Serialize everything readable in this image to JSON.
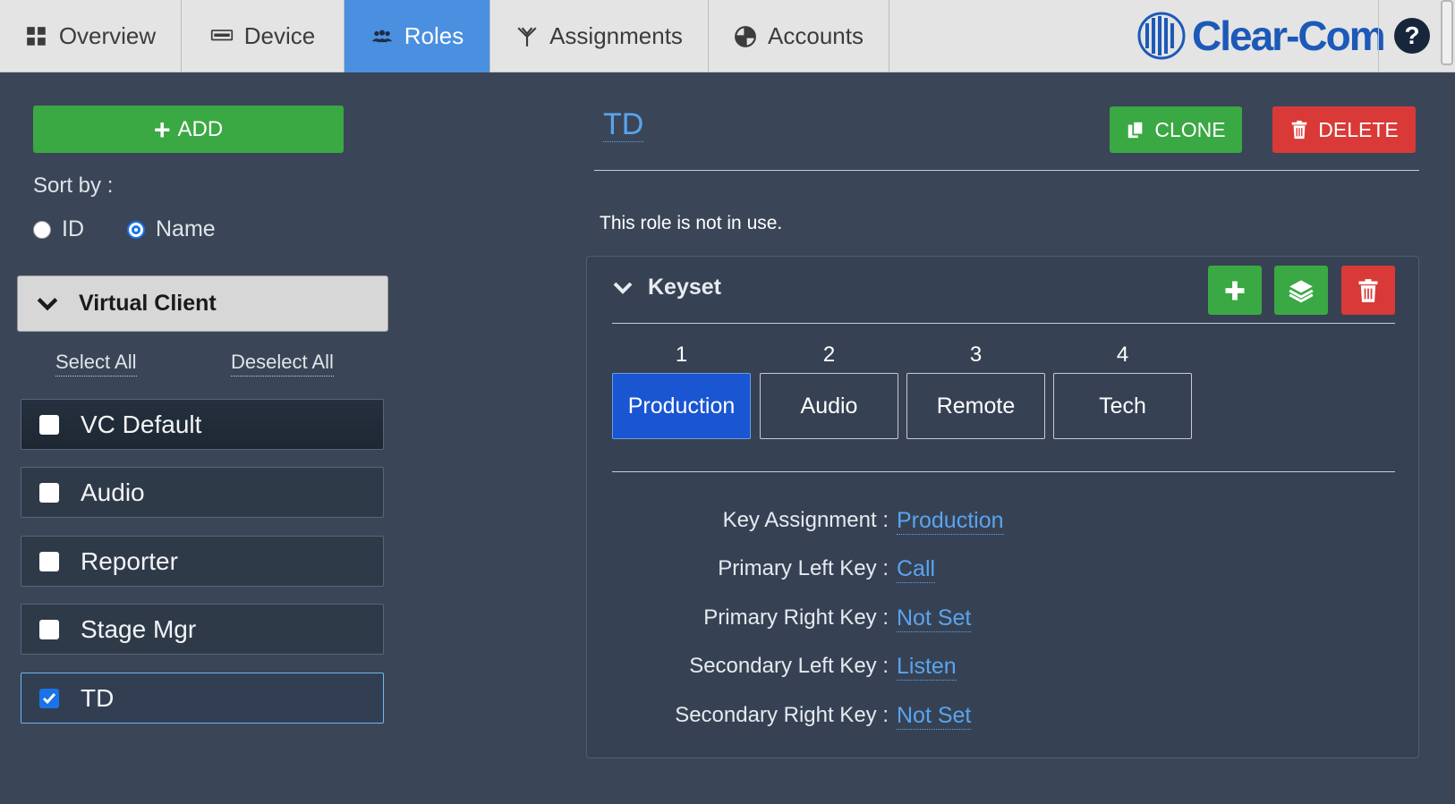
{
  "nav": {
    "tabs": [
      {
        "label": "Overview",
        "icon": "grid-icon"
      },
      {
        "label": "Device",
        "icon": "device-icon"
      },
      {
        "label": "Roles",
        "icon": "users-icon",
        "active": true
      },
      {
        "label": "Assignments",
        "icon": "assignments-icon"
      },
      {
        "label": "Accounts",
        "icon": "accounts-icon"
      }
    ],
    "logo_text": "Clear-Com",
    "help_label": "?"
  },
  "sidebar": {
    "add_label": "ADD",
    "sort_label": "Sort by :",
    "sort_options": [
      {
        "label": "ID",
        "checked": false
      },
      {
        "label": "Name",
        "checked": true
      }
    ],
    "group_label": "Virtual Client",
    "select_all": "Select All",
    "deselect_all": "Deselect All",
    "roles": [
      {
        "label": "VC Default",
        "checked": false
      },
      {
        "label": "Audio",
        "checked": false
      },
      {
        "label": "Reporter",
        "checked": false
      },
      {
        "label": "Stage Mgr",
        "checked": false
      },
      {
        "label": "TD",
        "checked": true
      }
    ]
  },
  "detail": {
    "title": "TD",
    "clone_label": "CLONE",
    "delete_label": "DELETE",
    "status": "This role is not in use.",
    "keyset": {
      "heading": "Keyset",
      "keys": [
        {
          "num": "1",
          "label": "Production",
          "active": true
        },
        {
          "num": "2",
          "label": "Audio"
        },
        {
          "num": "3",
          "label": "Remote"
        },
        {
          "num": "4",
          "label": "Tech"
        }
      ],
      "fields": [
        {
          "label": "Key Assignment :",
          "value": "Production"
        },
        {
          "label": "Primary Left Key :",
          "value": "Call"
        },
        {
          "label": "Primary Right Key :",
          "value": "Not Set"
        },
        {
          "label": "Secondary Left Key :",
          "value": "Listen"
        },
        {
          "label": "Secondary Right Key :",
          "value": "Not Set"
        }
      ]
    }
  },
  "colors": {
    "background": "#3a4657",
    "accent_blue": "#4a8fe0",
    "active_key": "#1a55d2",
    "green": "#3aa843",
    "red": "#d93a37",
    "link": "#5aa4ef",
    "brand": "#1c59b8"
  }
}
